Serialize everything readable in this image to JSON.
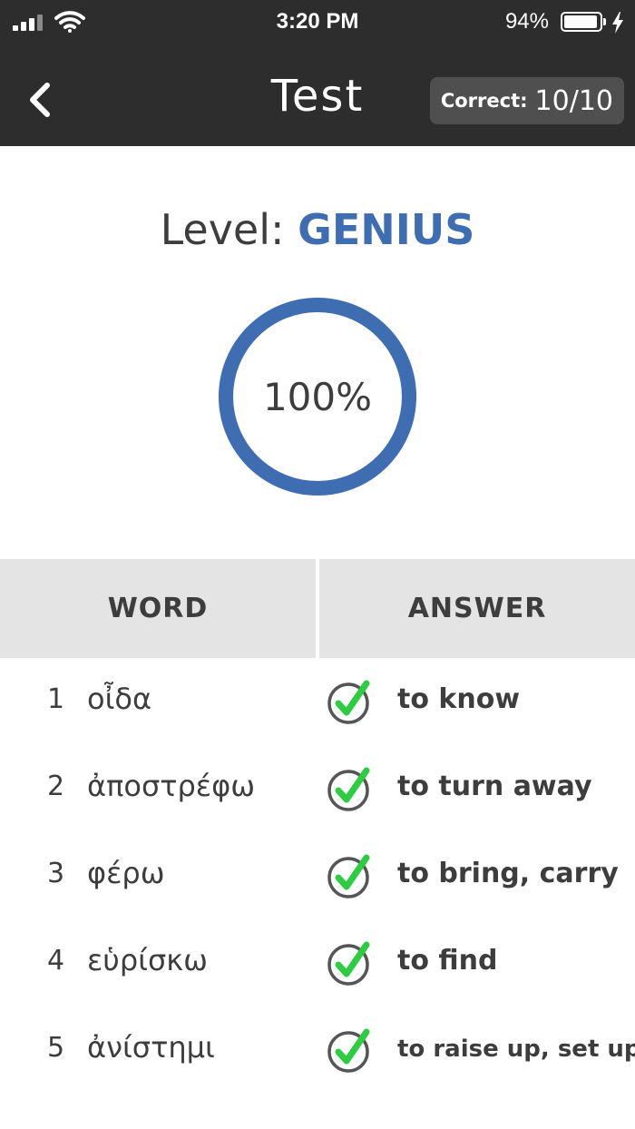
{
  "status_bar": {
    "time": "3:20 PM",
    "battery_percent": "94%",
    "battery_level": 0.94
  },
  "nav": {
    "title": "Test",
    "back_icon": "chevron-left-icon",
    "correct_label": "Correct:",
    "correct_value": "10/10"
  },
  "level": {
    "label": "Level:",
    "value": "GENIUS"
  },
  "progress": {
    "text": "100%",
    "fraction": 1.0,
    "color": "#3e6eb1"
  },
  "table": {
    "headers": [
      "WORD",
      "ANSWER"
    ],
    "rows": [
      {
        "num": "1",
        "word": "οἶδα",
        "answer": "to know",
        "correct": true
      },
      {
        "num": "2",
        "word": "ἀποστρέφω",
        "answer": "to turn away",
        "correct": true
      },
      {
        "num": "3",
        "word": "φέρω",
        "answer": "to bring, carry",
        "correct": true
      },
      {
        "num": "4",
        "word": "εὑρίσκω",
        "answer": "to find",
        "correct": true
      },
      {
        "num": "5",
        "word": "ἀνίστημι",
        "answer": "to raise up, set up",
        "correct": true
      }
    ]
  },
  "colors": {
    "header_bg": "#2d2d2d",
    "accent": "#3e6eb1",
    "check_green": "#2ecc40"
  }
}
